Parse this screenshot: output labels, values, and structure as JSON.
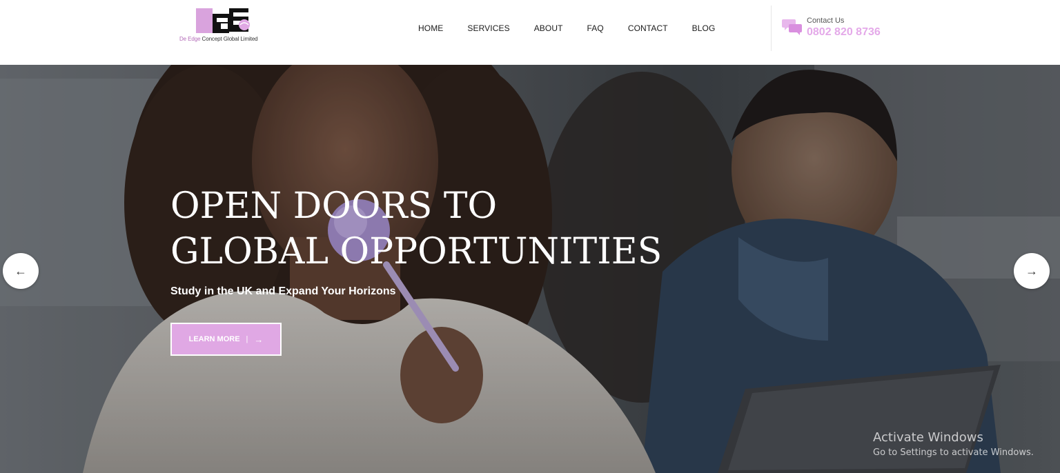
{
  "header": {
    "logo": {
      "mark": "EGE",
      "text_brand": "De Edge",
      "text_rest": " Concept Global Limited"
    },
    "nav": [
      {
        "label": "HOME"
      },
      {
        "label": "SERVICES"
      },
      {
        "label": "ABOUT"
      },
      {
        "label": "FAQ"
      },
      {
        "label": "CONTACT"
      },
      {
        "label": "BLOG"
      }
    ],
    "contact": {
      "icon": "chat-bubbles-icon",
      "label": "Contact Us",
      "phone": "0802 820 8736"
    }
  },
  "hero": {
    "title_line1": "OPEN DOORS TO",
    "title_line2": "GLOBAL OPPORTUNITIES",
    "subtitle": "Study in the UK and Expand Your Horizons",
    "cta_label": "LEARN MORE",
    "cta_separator": "|",
    "cta_arrow": "→",
    "prev_arrow": "←",
    "next_arrow": "→"
  },
  "watermark": {
    "title": "Activate Windows",
    "subtitle": "Go to Settings to activate Windows."
  },
  "colors": {
    "accent": "#e0a8e4",
    "phone": "#e4a9e9",
    "logo_purple": "#b36bb8"
  }
}
